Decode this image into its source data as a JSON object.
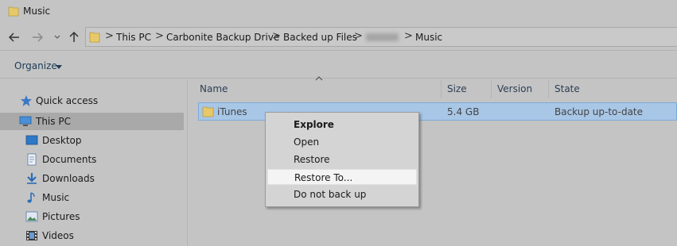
{
  "window": {
    "title": "Music",
    "folder_icon": "folder-icon"
  },
  "nav": {
    "back_icon": "back-arrow-icon",
    "forward_icon": "forward-arrow-icon",
    "recent_icon": "chevron-down-icon",
    "up_icon": "up-arrow-icon"
  },
  "breadcrumb": {
    "items": [
      "This PC",
      "Carbonite Backup Drive",
      "Backed up Files",
      "Music"
    ],
    "separator": ">"
  },
  "ribbon": {
    "organize_label": "Organize"
  },
  "navpane": {
    "items": [
      {
        "label": "Quick access",
        "icon": "star-icon"
      },
      {
        "label": "This PC",
        "icon": "computer-icon"
      },
      {
        "label": "Desktop",
        "icon": "desktop-icon"
      },
      {
        "label": "Documents",
        "icon": "documents-icon"
      },
      {
        "label": "Downloads",
        "icon": "downloads-icon"
      },
      {
        "label": "Music",
        "icon": "music-icon"
      },
      {
        "label": "Pictures",
        "icon": "pictures-icon"
      },
      {
        "label": "Videos",
        "icon": "videos-icon"
      }
    ]
  },
  "table": {
    "columns": [
      "Name",
      "Size",
      "Version",
      "State"
    ],
    "rows": [
      {
        "name": "iTunes",
        "size": "5.4 GB",
        "version": "",
        "state": "Backup up-to-date"
      }
    ]
  },
  "context_menu": {
    "items": [
      "Explore",
      "Open",
      "Restore",
      "Restore To...",
      "Do not back up"
    ]
  },
  "colors": {
    "selection": "#a8c6e6",
    "background": "#c4c4c4",
    "menu_highlight": "#f4f4f4"
  }
}
